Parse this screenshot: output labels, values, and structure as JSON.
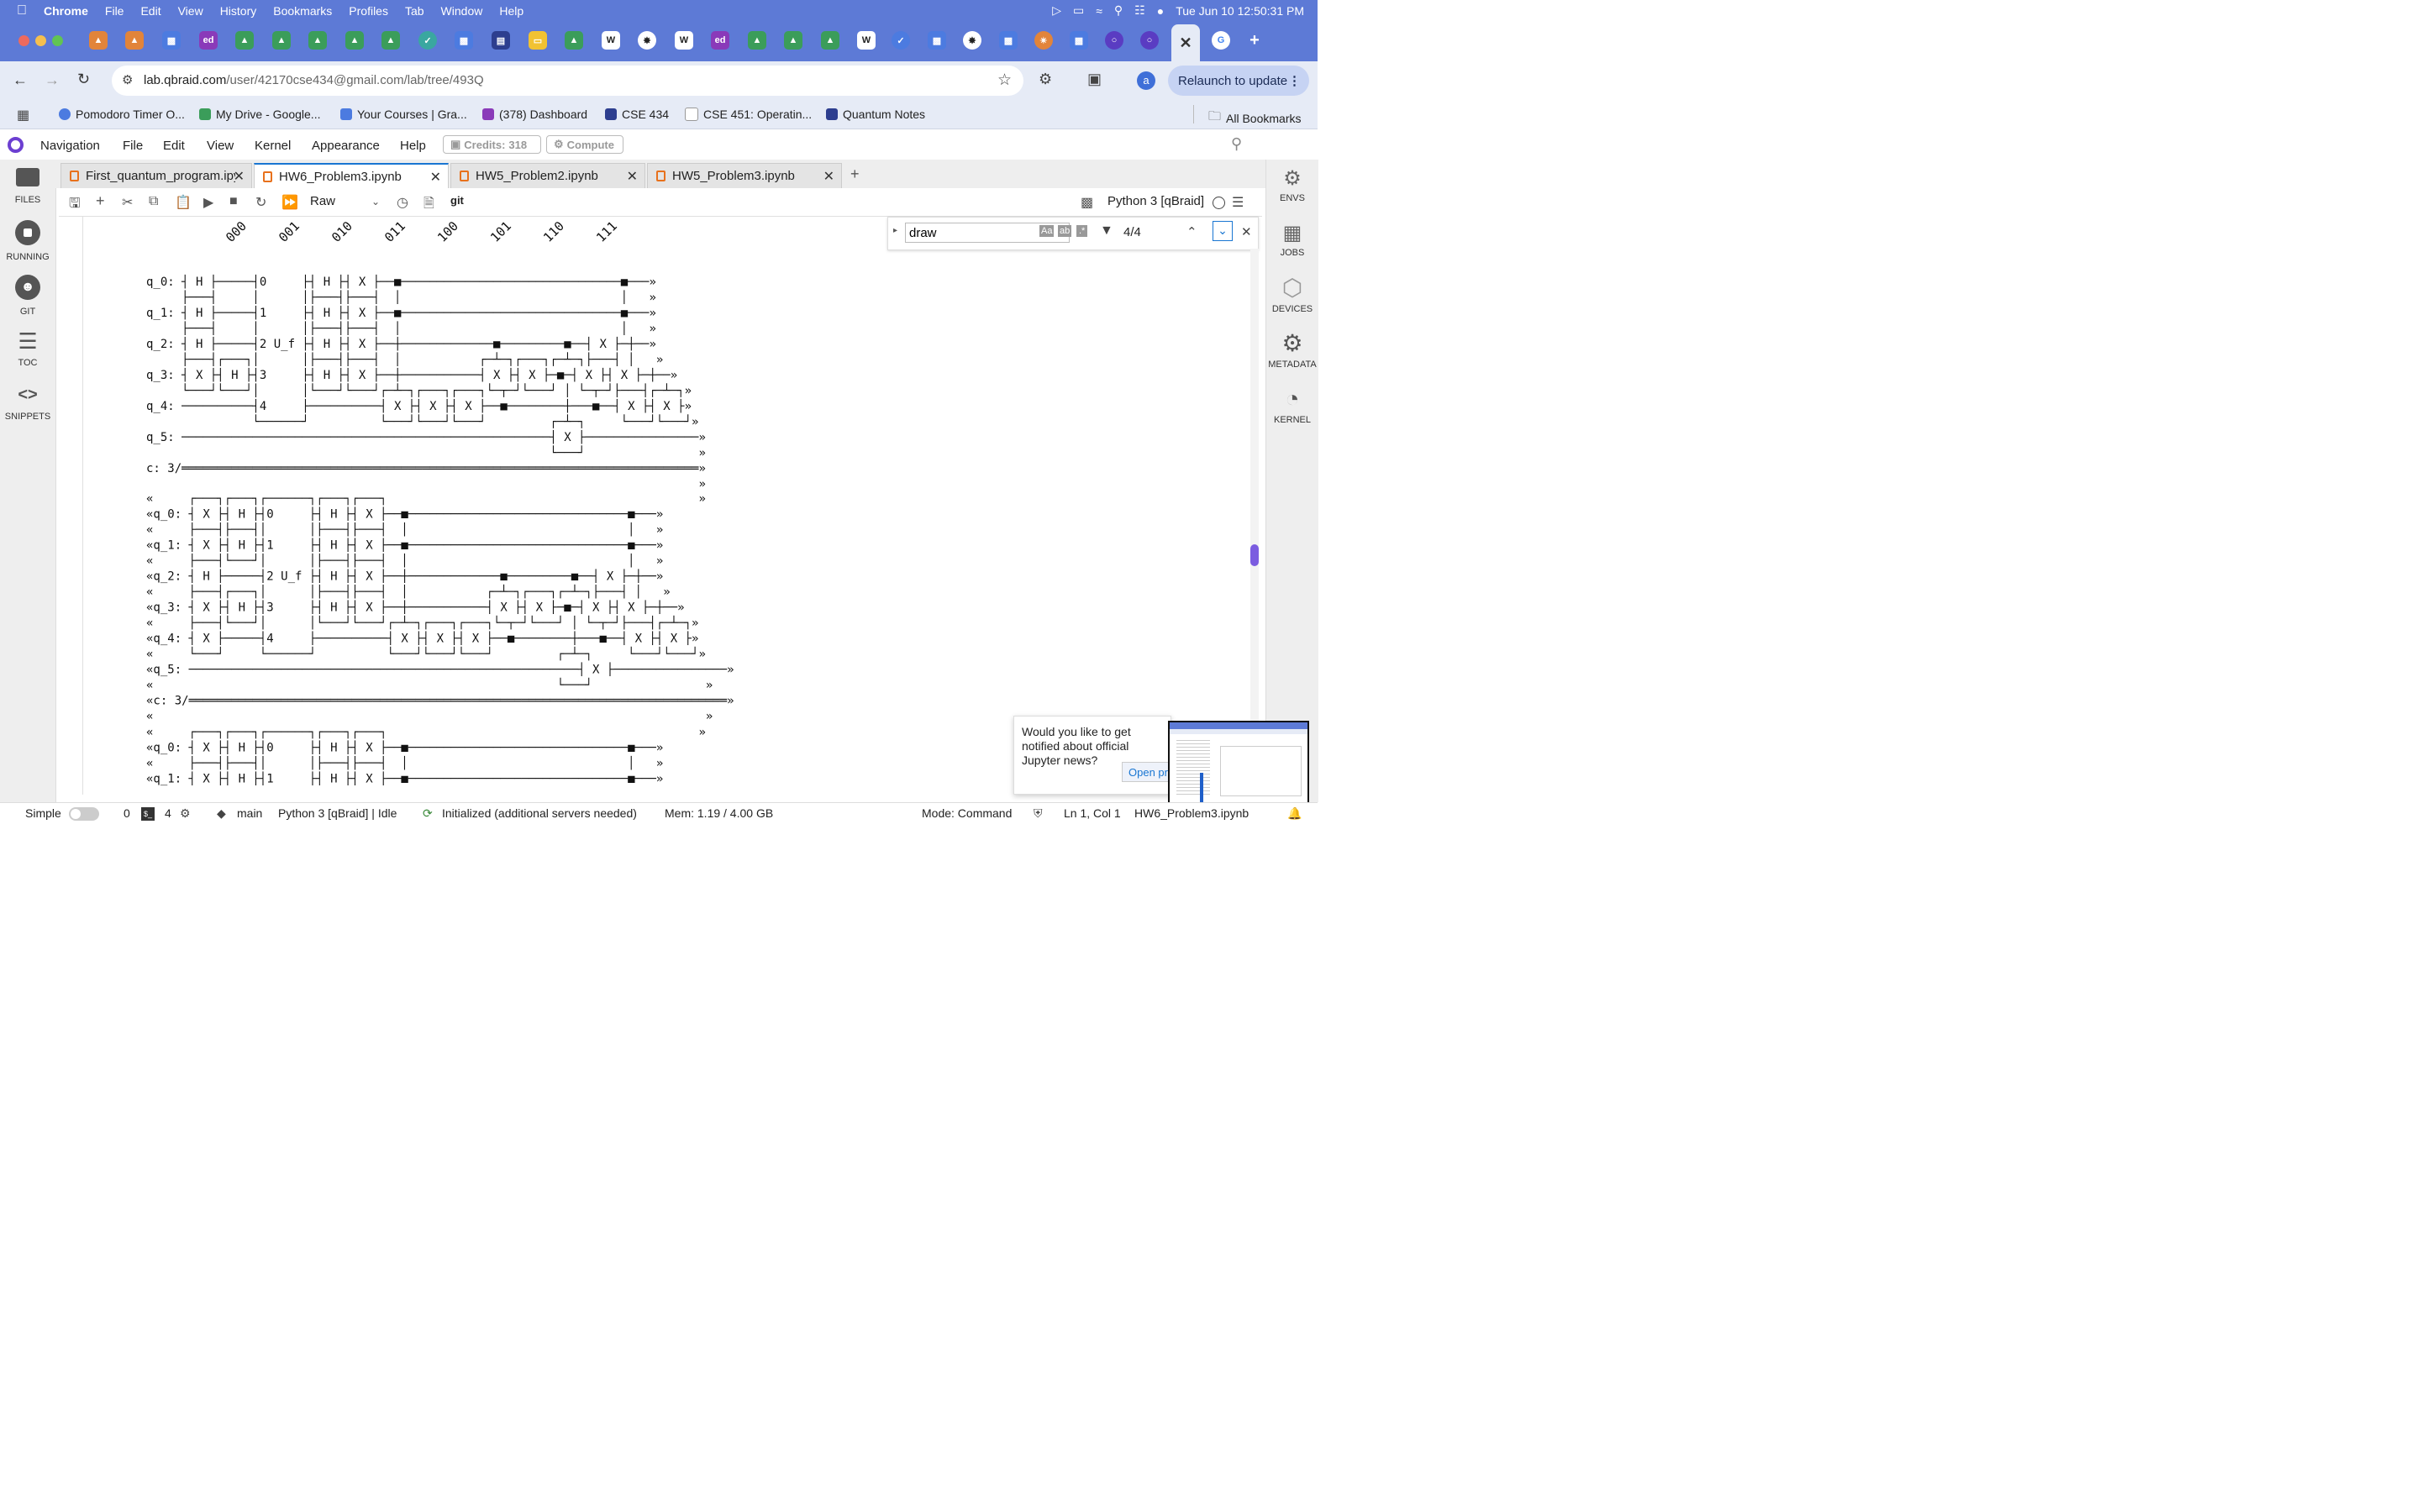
{
  "mac_menu": {
    "app": "Chrome",
    "items": [
      "File",
      "Edit",
      "View",
      "History",
      "Bookmarks",
      "Profiles",
      "Tab",
      "Window",
      "Help"
    ],
    "datetime": "Tue Jun 10  12:50:31 PM"
  },
  "browser": {
    "url_host": "lab.qbraid.com",
    "url_path": "/user/42170cse434@gmail.com/lab/tree/493Q",
    "relaunch_label": "Relaunch to update",
    "profile_initial": "a"
  },
  "bookmarks": [
    "Pomodoro Timer O...",
    "My Drive - Google...",
    "Your Courses | Gra...",
    "(378) Dashboard",
    "CSE 434",
    "CSE 451: Operatin...",
    "Quantum Notes"
  ],
  "all_bookmarks": "All Bookmarks",
  "jupyter_menu": {
    "items": [
      "Navigation",
      "File",
      "Edit",
      "View",
      "Kernel",
      "Appearance",
      "Help"
    ],
    "credits_label": "Credits:",
    "credits_value": "318",
    "compute_label": "Compute"
  },
  "left_sidebar": [
    "FILES",
    "RUNNING",
    "GIT",
    "TOC",
    "SNIPPETS"
  ],
  "right_sidebar": [
    "ENVS",
    "JOBS",
    "DEVICES",
    "METADATA",
    "KERNEL"
  ],
  "doc_tabs": [
    "First_quantum_program.ipynb",
    "HW6_Problem3.ipynb",
    "HW5_Problem2.ipynb",
    "HW5_Problem3.ipynb"
  ],
  "toolbar": {
    "cell_type": "Raw",
    "git_label": "git",
    "kernel_name": "Python 3 [qBraid]"
  },
  "find": {
    "query": "draw",
    "count": "4/4"
  },
  "circuit": {
    "axis_labels": [
      "000",
      "001",
      "010",
      "011",
      "100",
      "101",
      "110",
      "111"
    ],
    "block1": [
      "q_0: ┤ H ├─────┤0     ├┤ H ├┤ X ├──■───────────────────────────────■───»",
      "     ├───┤     │      │├───┤├───┤  │                               │   »",
      "q_1: ┤ H ├─────┤1     ├┤ H ├┤ X ├──■───────────────────────────────■───»",
      "     ├───┤     │      │├───┤├───┤  │                               │   »",
      "q_2: ┤ H ├─────┤2 U_f ├┤ H ├┤ X ├──┼─────────────■─────────■──┤ X ├─┼──»",
      "     ├───┤┌───┐│      │├───┤├───┤  │           ┌─┴─┐┌───┐┌─┴─┐├───┤ │   »",
      "q_3: ┤ X ├┤ H ├┤3     ├┤ H ├┤ X ├──┼───────────┤ X ├┤ X ├─■─┤ X ├┤ X ├─┼──»",
      "     └───┘└───┘│      │└───┘└───┘┌─┴─┐┌───┐┌───┐└─┬─┘└───┘ │ └─┬─┘├───┤┌─┴─┐»",
      "q_4: ──────────┤4     ├──────────┤ X ├┤ X ├┤ X ├──■────────┼───■──┤ X ├┤ X ├»",
      "               └──────┘          └───┘└───┘└───┘         ┌─┴─┐     └───┘└───┘»",
      "q_5: ────────────────────────────────────────────────────┤ X ├────────────────»",
      "                                                         └───┘                »",
      "c: 3/═════════════════════════════════════════════════════════════════════════»",
      "                                                                              »"
    ],
    "block2": [
      "«     ┌───┐┌───┐┌──────┐┌───┐┌───┐                                            »",
      "«q_0: ┤ X ├┤ H ├┤0     ├┤ H ├┤ X ├──■───────────────────────────────■───»",
      "«     ├───┤├───┤│      │├───┤├───┤  │                               │   »",
      "«q_1: ┤ X ├┤ H ├┤1     ├┤ H ├┤ X ├──■───────────────────────────────■───»",
      "«     ├───┤└───┘│      │├───┤├───┤  │                               │   »",
      "«q_2: ┤ H ├─────┤2 U_f ├┤ H ├┤ X ├──┼─────────────■─────────■──┤ X ├─┼──»",
      "«     ├───┤┌───┐│      │├───┤├───┤  │           ┌─┴─┐┌───┐┌─┴─┐├───┤ │   »",
      "«q_3: ┤ X ├┤ H ├┤3     ├┤ H ├┤ X ├──┼───────────┤ X ├┤ X ├─■─┤ X ├┤ X ├─┼──»",
      "«     ├───┤└───┘│      │└───┘└───┘┌─┴─┐┌───┐┌───┐└─┬─┘└───┘ │ └─┬─┘├───┤┌─┴─┐»",
      "«q_4: ┤ X ├─────┤4     ├──────────┤ X ├┤ X ├┤ X ├──■────────┼───■──┤ X ├┤ X ├»",
      "«     └───┘     └──────┘          └───┘└───┘└───┘         ┌─┴─┐     └───┘└───┘»",
      "«q_5: ───────────────────────────────────────────────────────┤ X ├────────────────»",
      "«                                                         └───┘                »",
      "«c: 3/════════════════════════════════════════════════════════════════════════════»",
      "«                                                                              »"
    ],
    "block3": [
      "«     ┌───┐┌───┐┌──────┐┌───┐┌───┐                                            »",
      "«q_0: ┤ X ├┤ H ├┤0     ├┤ H ├┤ X ├──■───────────────────────────────■───»",
      "«     ├───┤├───┤│      │├───┤├───┤  │                               │   »",
      "«q_1: ┤ X ├┤ H ├┤1     ├┤ H ├┤ X ├──■───────────────────────────────■───»"
    ]
  },
  "notification": {
    "text": "Would you like to get notified about official Jupyter news?",
    "open_label": "Open privacy policy"
  },
  "status": {
    "mode_simple": "Simple",
    "terminals": "0",
    "kernels": "4",
    "branch": "main",
    "kernel_status": "Python 3 [qBraid] | Idle",
    "init_msg": "Initialized (additional servers needed)",
    "mem": "Mem: 1.19 / 4.00 GB",
    "mode": "Mode: Command",
    "cursor": "Ln 1, Col 1",
    "filename": "HW6_Problem3.ipynb"
  }
}
